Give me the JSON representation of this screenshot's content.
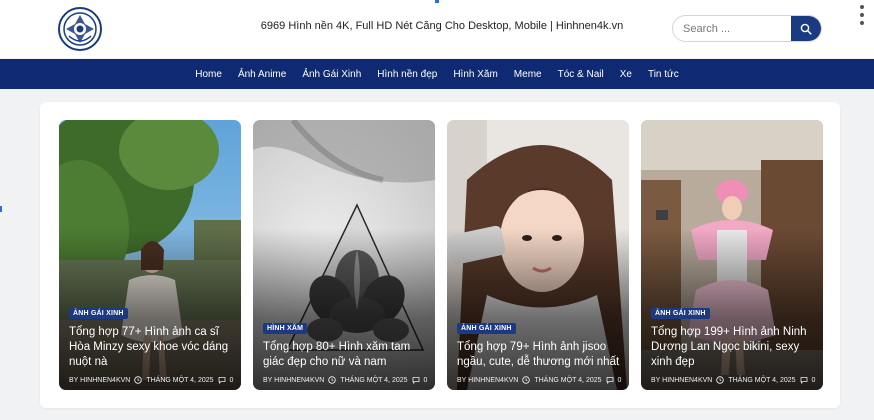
{
  "header": {
    "tagline": "6969 Hình nền 4K, Full HD Nét Căng Cho Desktop, Mobile | Hinhnen4k.vn",
    "search_placeholder": "Search ..."
  },
  "nav": [
    "Home",
    "Ảnh Anime",
    "Ảnh Gái Xinh",
    "Hình nền đẹp",
    "Hình Xăm",
    "Meme",
    "Tóc & Nail",
    "Xe",
    "Tin tức"
  ],
  "colors": {
    "brand": "#0f2a72",
    "badge": "#1b3a82",
    "accent": "#2b6ed6"
  },
  "posts": [
    {
      "category": "ẢNH GÁI XINH",
      "title": "Tổng hợp 77+ Hình ảnh ca sĩ Hòa Minzy sexy khoe vóc dáng nuột nà",
      "author": "BY HINHNEN4KVN",
      "date": "THÁNG MỘT 4, 2025",
      "comments": "0"
    },
    {
      "category": "HÌNH XĂM",
      "title": "Tổng hợp 80+ Hình xăm tam giác đẹp cho nữ và nam",
      "author": "BY HINHNEN4KVN",
      "date": "THÁNG MỘT 4, 2025",
      "comments": "0"
    },
    {
      "category": "ẢNH GÁI XINH",
      "title": "Tổng hợp 79+ Hình ảnh jisoo ngầu, cute, dễ thương mới nhất",
      "author": "BY HINHNEN4KVN",
      "date": "THÁNG MỘT 4, 2025",
      "comments": "0"
    },
    {
      "category": "ẢNH GÁI XINH",
      "title": "Tổng hợp 199+ Hình ảnh Ninh Dương Lan Ngọc bikini, sexy xinh đẹp",
      "author": "BY HINHNEN4KVN",
      "date": "THÁNG MỘT 4, 2025",
      "comments": "0"
    }
  ]
}
